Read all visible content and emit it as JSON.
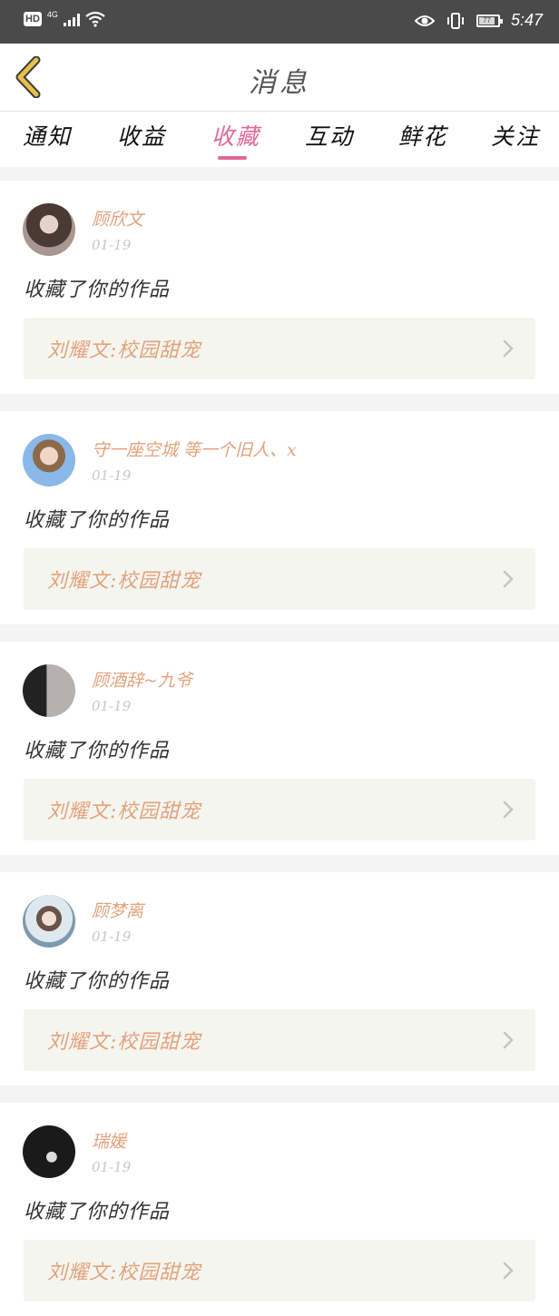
{
  "status_bar": {
    "hd": "HD",
    "network": "4G",
    "time": "5:47",
    "battery": "77",
    "icons": [
      "signal-icon",
      "wifi-icon",
      "eye-icon",
      "vibrate-icon",
      "battery-icon"
    ]
  },
  "header": {
    "title": "消息",
    "back_icon": "chevron-left-icon"
  },
  "tabs": [
    {
      "label": "通知"
    },
    {
      "label": "收益"
    },
    {
      "label": "收藏",
      "active": true
    },
    {
      "label": "互动"
    },
    {
      "label": "鲜花"
    },
    {
      "label": "关注"
    }
  ],
  "messages": [
    {
      "user": "顾欣文",
      "date": "01-19",
      "action": "收藏了你的作品",
      "work": "刘耀文:校园甜宠"
    },
    {
      "user": "守一座空城 等一个旧人、x",
      "date": "01-19",
      "action": "收藏了你的作品",
      "work": "刘耀文:校园甜宠"
    },
    {
      "user": "顾酒辞~九爷",
      "date": "01-19",
      "action": "收藏了你的作品",
      "work": "刘耀文:校园甜宠"
    },
    {
      "user": "顾梦离",
      "date": "01-19",
      "action": "收藏了你的作品",
      "work": "刘耀文:校园甜宠"
    },
    {
      "user": "瑞媛",
      "date": "01-19",
      "action": "收藏了你的作品",
      "work": "刘耀文:校园甜宠"
    }
  ],
  "colors": {
    "accent": "#e0679a",
    "username": "#e2a27c",
    "back_icon": "#e6c04a"
  }
}
